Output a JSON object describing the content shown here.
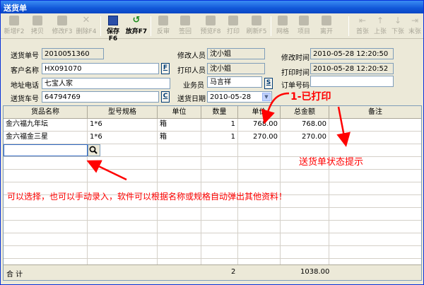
{
  "window": {
    "title": "送货单"
  },
  "toolbar": {
    "new": "新增F2",
    "copy": "拷贝",
    "edit": "修改F3",
    "delete": "删除F4",
    "save": "保存F6",
    "discard": "放弃F7",
    "audit_rev": "反审",
    "audit": "签回",
    "preview": "预览F8",
    "print": "打印",
    "refresh": "刷新F5",
    "grid": "网格",
    "item": "项目",
    "exit": "离开",
    "first": "首张",
    "prev": "上张",
    "next": "下张",
    "last": "末张"
  },
  "form": {
    "order_no_label": "送货单号",
    "order_no": "2010051360",
    "customer_label": "客户名称",
    "customer": "HX091070",
    "address_label": "地址电话",
    "address": "七宝人家",
    "car_label": "送货车号",
    "car": "64794769",
    "modifier_label": "修改人员",
    "modifier": "沈小姐",
    "printer_label": "打印人员",
    "printer": "沈小姐",
    "sales_label": "业务员",
    "sales": "马言祥",
    "date_label": "送货日期",
    "date": "2010-05-28",
    "mod_time_label": "修改时间",
    "mod_time": "2010-05-28 12:20:50",
    "print_time_label": "打印时间",
    "print_time": "2010-05-28 12:20:52",
    "order_label": "订单号码",
    "order": "",
    "btn_f": "F",
    "btn_c": "C",
    "btn_s": "S"
  },
  "grid": {
    "headers": [
      "货品名称",
      "型号规格",
      "单位",
      "数量",
      "单价",
      "总金额",
      "备注"
    ],
    "rows": [
      [
        "金六福九年坛",
        "1*6",
        "箱",
        "1",
        "768.00",
        "768.00",
        ""
      ],
      [
        "金六福金三星",
        "1*6",
        "箱",
        "1",
        "270.00",
        "270.00",
        ""
      ]
    ],
    "footer_label": "合 计",
    "footer_qty": "2",
    "footer_total": "1038.00"
  },
  "annotations": {
    "status": "1-已打印",
    "status_hint": "送货单状态提示",
    "input_hint": "可以选择，也可以手动录入，软件可以根据名称或规格自动弹出其他资料！"
  },
  "colors": {
    "annotation": "#ff0000",
    "titlebar": "#1157d8",
    "window_bg": "#ece9d8"
  }
}
